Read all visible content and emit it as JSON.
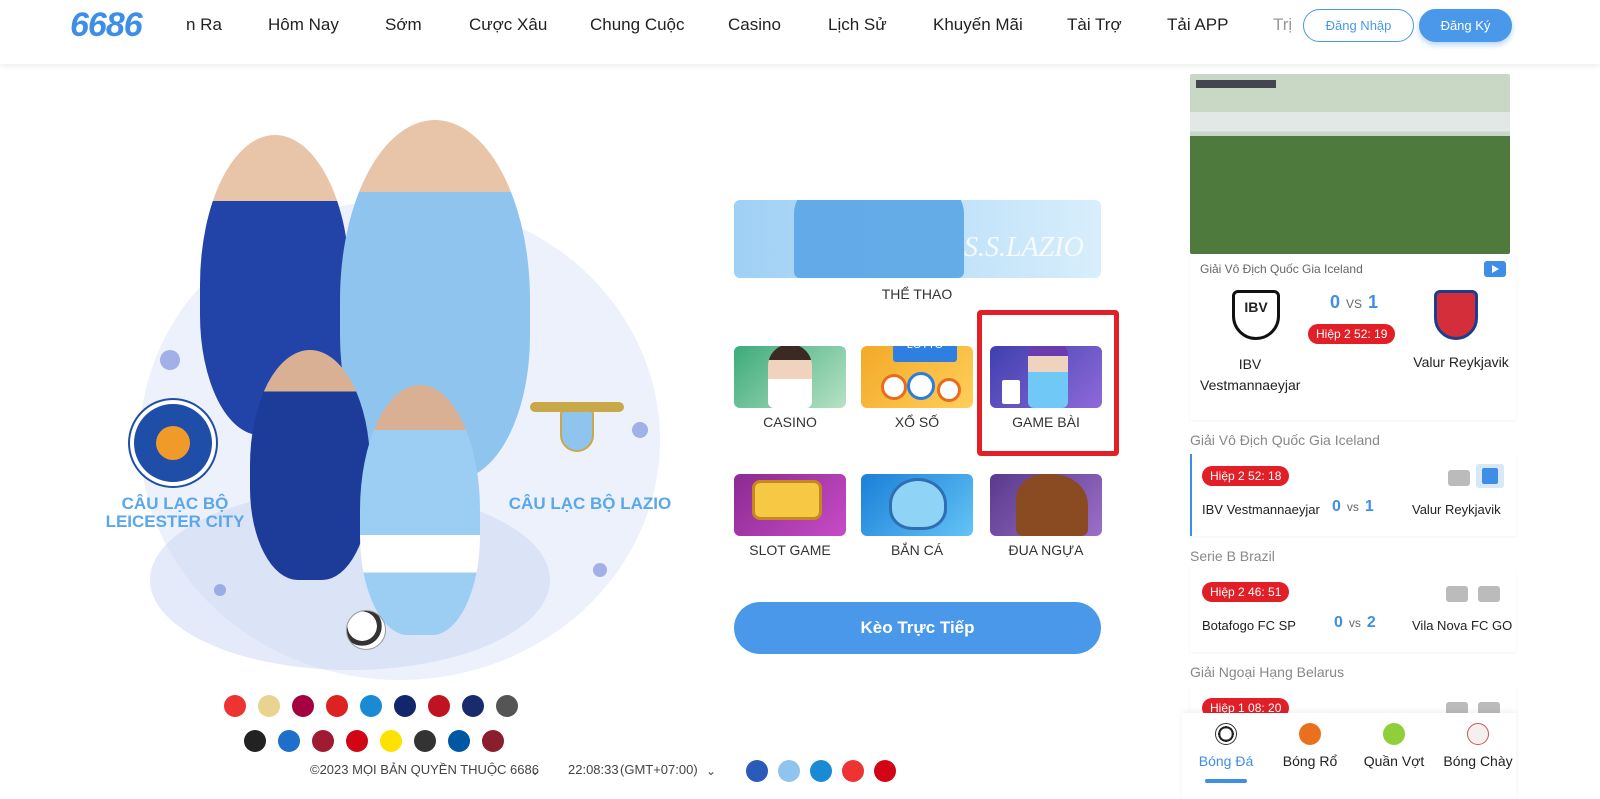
{
  "nav": {
    "logo": "6686",
    "links": [
      "n Ra",
      "Hôm Nay",
      "Sớm",
      "Cược Xâu",
      "Chung Cuộc",
      "Casino",
      "Lịch Sử",
      "Khuyến Mãi",
      "Tài Trợ",
      "Tải APP",
      "Trị"
    ],
    "login_label": "Đăng Nhập",
    "register_label": "Đăng Ký"
  },
  "hero": {
    "leicester_caption": "CÂU LẠC BỘ LEICESTER CITY",
    "lazio_caption": "CÂU LẠC BỘ LAZIO"
  },
  "games": {
    "sports_banner_text": "S.S.LAZIO",
    "sports_label": "THỂ THAO",
    "tiles": [
      {
        "label": "CASINO"
      },
      {
        "label": "XỔ SỐ"
      },
      {
        "label": "GAME BÀI"
      },
      {
        "label": "SLOT GAME"
      },
      {
        "label": "BẮN CÁ"
      },
      {
        "label": "ĐUA NGỰA"
      }
    ],
    "lotto_text": "LOTTO",
    "cta_label": "Kèo Trực Tiếp"
  },
  "footer": {
    "copyright": "©2023 MỌI BẢN QUYỀN THUỘC 6686",
    "time": "22:08:33",
    "timezone": "(GMT+07:00)"
  },
  "featured": {
    "league": "Giải Vô Địch Quốc Gia Iceland",
    "home_score": "0",
    "vs": "VS",
    "away_score": "1",
    "status": "Hiệp 2   52: 19",
    "home_team": "IBV Vestmannaeyjar",
    "away_team": "Valur Reykjavik",
    "home_crest_text": "IBV"
  },
  "matches": [
    {
      "league": "Giải Vô Địch Quốc Gia Iceland",
      "status": "Hiệp 2   52: 18",
      "home": "IBV Vestmannaeyjar",
      "home_score": "0",
      "vs": "vs",
      "away_score": "1",
      "away": "Valur Reykjavik"
    },
    {
      "league": "Serie B Brazil",
      "status": "Hiệp 2   46: 51",
      "home": "Botafogo FC SP",
      "home_score": "0",
      "vs": "vs",
      "away_score": "2",
      "away": "Vila Nova FC GO"
    },
    {
      "league": "Giải Ngoại Hạng Belarus",
      "status": "Hiệp 1   08: 20"
    }
  ],
  "sports": [
    "Bóng Đá",
    "Bóng Rổ",
    "Quần Vợt",
    "Bóng Chày"
  ],
  "colors": {
    "accent": "#4a98e9",
    "live": "#e21f27",
    "highlight_box": "#e21f27"
  }
}
